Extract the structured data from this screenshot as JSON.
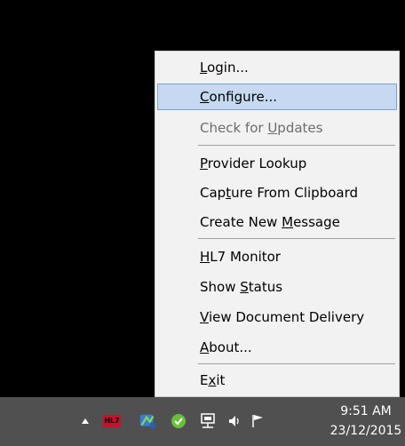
{
  "menu": {
    "items": [
      {
        "id": "login",
        "pre": "",
        "u": "L",
        "post": "ogin...",
        "state": "normal"
      },
      {
        "id": "configure",
        "pre": "",
        "u": "C",
        "post": "onfigure...",
        "state": "hover"
      },
      {
        "id": "check-updates",
        "pre": "Check for ",
        "u": "U",
        "post": "pdates",
        "state": "disabled"
      },
      {
        "id": "provider-lookup",
        "pre": "",
        "u": "P",
        "post": "rovider Lookup",
        "state": "normal"
      },
      {
        "id": "capture-clipboard",
        "pre": "Cap",
        "u": "t",
        "post": "ure From Clipboard",
        "state": "normal"
      },
      {
        "id": "create-message",
        "pre": "Create New ",
        "u": "M",
        "post": "essage",
        "state": "normal"
      },
      {
        "id": "hl7-monitor",
        "pre": "",
        "u": "H",
        "post": "L7 Monitor",
        "state": "normal"
      },
      {
        "id": "show-status",
        "pre": "Show ",
        "u": "S",
        "post": "tatus",
        "state": "normal"
      },
      {
        "id": "view-document-delivery",
        "pre": "",
        "u": "V",
        "post": "iew Document Delivery",
        "state": "normal"
      },
      {
        "id": "about",
        "pre": "",
        "u": "A",
        "post": "bout...",
        "state": "normal"
      },
      {
        "id": "exit",
        "pre": "E",
        "u": "x",
        "post": "it",
        "state": "normal"
      }
    ]
  },
  "taskbar": {
    "hl7_icon_text": "HL7",
    "time": "9:51 AM",
    "date": "23/12/2015"
  },
  "colors": {
    "menu_bg": "#f2f2f2",
    "hover_bg": "#c6d9f0",
    "hover_border": "#7da2ce",
    "taskbar_bg": "#505050"
  }
}
